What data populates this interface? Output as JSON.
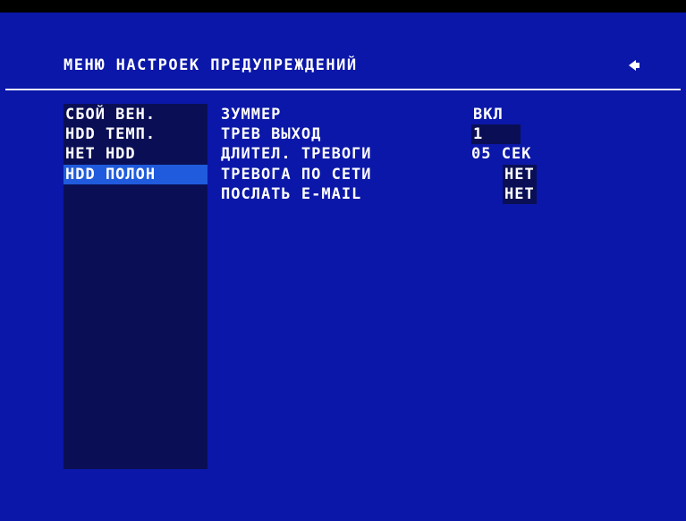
{
  "menu": {
    "title": "МЕНЮ НАСТРОЕК ПРЕДУПРЕЖДЕНИЙ",
    "back_icon": "left-arrow-icon"
  },
  "left_items": [
    {
      "label": "СБОЙ ВЕН."
    },
    {
      "label": "HDD ТЕМП."
    },
    {
      "label": "НЕТ HDD"
    },
    {
      "label": "HDD ПОЛОН"
    }
  ],
  "selected_left_item": "HDD ПОЛОН",
  "settings": [
    {
      "label": "ЗУММЕР",
      "value": "ВКЛ"
    },
    {
      "label": "ТРЕВ ВЫХОД",
      "value": "1"
    },
    {
      "label": "ДЛИТЕЛ. ТРЕВОГИ",
      "value": "05 СЕК"
    },
    {
      "label": "ТРЕВОГА ПО СЕТИ",
      "value": "НЕТ"
    },
    {
      "label": "ПОСЛАТЬ E-MAIL",
      "value": "НЕТ"
    }
  ],
  "colors": {
    "background": "#0b17a8",
    "panel": "#0a0f55",
    "selection": "#1f5bdc",
    "text": "#ffffff"
  }
}
